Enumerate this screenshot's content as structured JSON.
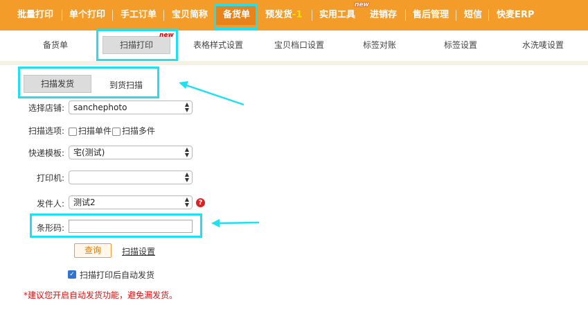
{
  "topnav": {
    "items": [
      "批量打印",
      "单个打印",
      "手工订单",
      "宝贝简称",
      "备货单",
      "预发货",
      "实用工具",
      "进销存",
      "售后管理",
      "短信",
      "快麦ERP"
    ],
    "prefahuo_badge": "-1",
    "new_badge": "new"
  },
  "subnav": {
    "items": [
      "备货单",
      "扫描打印",
      "表格样式设置",
      "宝贝档口设置",
      "标签对账",
      "标签设置",
      "水洗唛设置"
    ],
    "new_badge": "new"
  },
  "tabs": [
    "扫描发货",
    "到货扫描"
  ],
  "form": {
    "shop_label": "选择店铺:",
    "shop_value": "sanchephoto",
    "scan_option_label": "扫描选项:",
    "scan_single": "扫描单件",
    "scan_multi": "扫描多件",
    "express_label": "快递模板:",
    "express_value": "宅(测试)",
    "printer_label": "打印机:",
    "printer_value": "",
    "sender_label": "发件人:",
    "sender_value": "测试2",
    "barcode_label": "条形码:",
    "barcode_value": "",
    "query_button": "查询",
    "scan_settings_link": "扫描设置",
    "auto_ship_label": "扫描打印后自动发货",
    "warning": "*建议您开启自动发货功能，避免漏发货。"
  },
  "colors": {
    "nav_orange": "#f39c2a",
    "highlight_cyan": "#1ee0f0",
    "warning_red": "#e01010"
  }
}
